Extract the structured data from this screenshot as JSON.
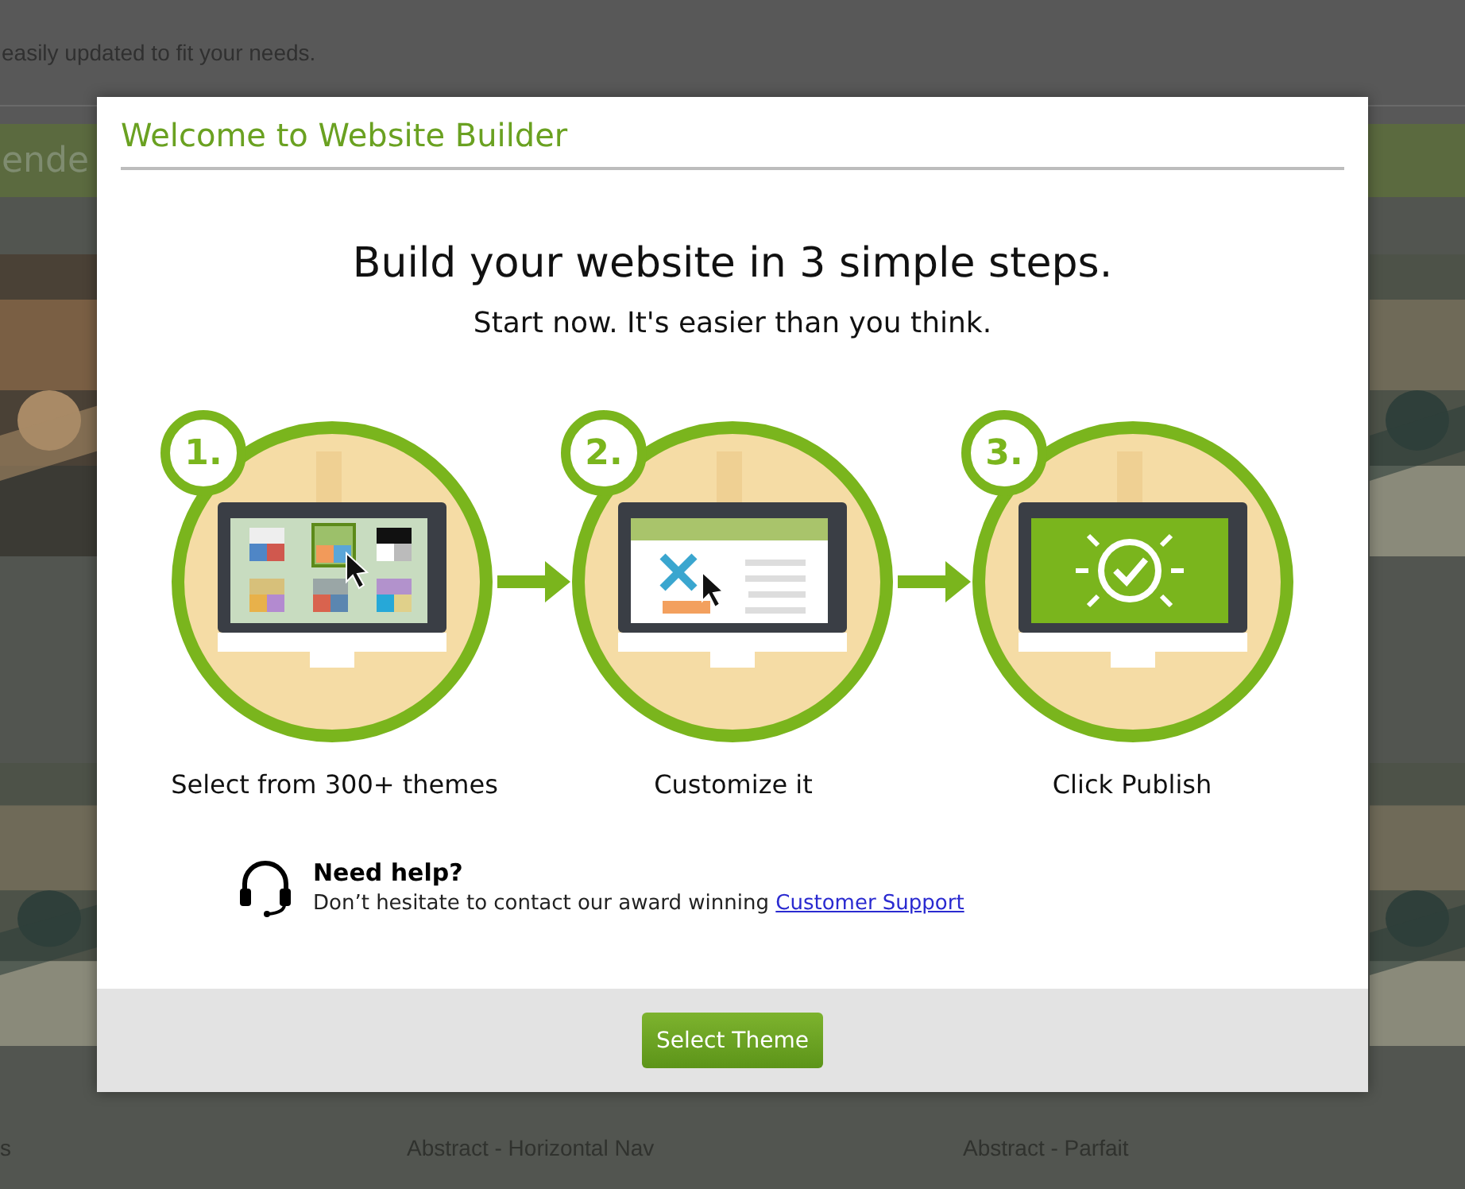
{
  "background": {
    "intro": "easily updated to fit your needs.",
    "banner": "ende",
    "captions": [
      "s",
      "Abstract - Horizontal Nav",
      "Abstract - Parfait"
    ]
  },
  "dialog": {
    "title": "Welcome to Website Builder",
    "heading": "Build your website in 3 simple steps.",
    "subheading": "Start now. It's easier than you think.",
    "steps": [
      {
        "number": "1.",
        "kind": "themes",
        "caption": "Select from 300+ themes"
      },
      {
        "number": "2.",
        "kind": "customize",
        "caption": "Customize it"
      },
      {
        "number": "3.",
        "kind": "publish",
        "caption": "Click Publish"
      }
    ],
    "help": {
      "title": "Need help?",
      "text": "Don’t hesitate to contact our award winning",
      "link": "Customer Support"
    },
    "button": "Select Theme"
  }
}
